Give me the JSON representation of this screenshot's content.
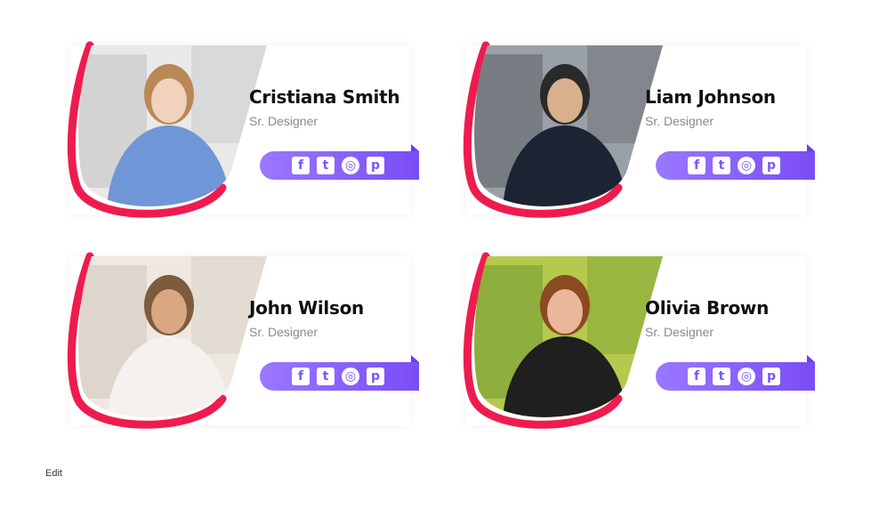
{
  "cards": [
    {
      "name": "Cristiana Smith",
      "role": "Sr. Designer",
      "palette": [
        "#c9c9c9",
        "#e9e9e9",
        "#6f96d6",
        "#f1d2bd",
        "#b98854"
      ]
    },
    {
      "name": "Liam Johnson",
      "role": "Sr. Designer",
      "palette": [
        "#6a6d74",
        "#9aa0a8",
        "#1c2333",
        "#d9b08c",
        "#2a2a2a"
      ]
    },
    {
      "name": "John Wilson",
      "role": "Sr. Designer",
      "palette": [
        "#d7cfc3",
        "#eee8e0",
        "#f4f1ee",
        "#d9a882",
        "#7d5b3c"
      ]
    },
    {
      "name": "Olivia Brown",
      "role": "Sr. Designer",
      "palette": [
        "#7ea336",
        "#b4c94d",
        "#1f1f1f",
        "#e9b89c",
        "#8a4b22"
      ]
    }
  ],
  "social_icons": [
    {
      "name": "facebook-icon",
      "glyph": "f"
    },
    {
      "name": "twitter-icon",
      "glyph": "t"
    },
    {
      "name": "instagram-icon",
      "glyph": "◎"
    },
    {
      "name": "pinterest-icon",
      "glyph": "p"
    }
  ],
  "theme": {
    "accent": "#ee1c4e",
    "social_bar": "#8a5cf6"
  },
  "edit_label": "Edit"
}
